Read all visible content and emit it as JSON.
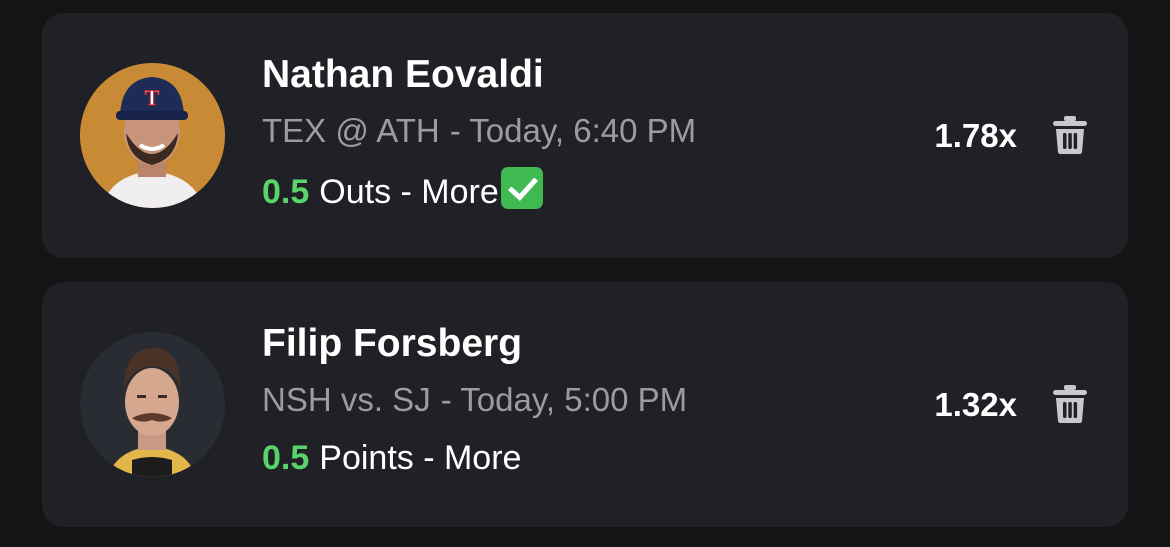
{
  "picks": [
    {
      "player": "Nathan Eovaldi",
      "game": "TEX @ ATH",
      "time": "- Today, 6:40 PM",
      "line": "0.5",
      "stat": "Outs - More",
      "result_icon": "check-mark-emoji",
      "multiplier": "1.78x",
      "avatar_bg": "#c98a36",
      "cap_logo": "T"
    },
    {
      "player": "Filip Forsberg",
      "game": "NSH vs. SJ",
      "time": "- Today, 5:00 PM",
      "line": "0.5",
      "stat": "Points - More",
      "multiplier": "1.32x",
      "avatar_bg": "#2a2c33"
    }
  ],
  "colors": {
    "background": "#141415",
    "card": "#202126",
    "accent_green": "#5ad36a",
    "muted_text": "#9b9ca3"
  },
  "icons": {
    "delete": "trash-icon"
  }
}
